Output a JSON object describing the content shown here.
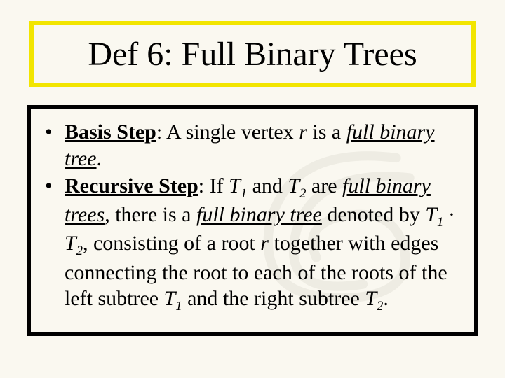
{
  "title": "Def 6: Full Binary Trees",
  "bullets": {
    "basis": {
      "label": "Basis Step",
      "pre": ": A single vertex ",
      "r": "r",
      "mid": " is a ",
      "fbt": "full binary tree",
      "tail": "."
    },
    "recursive": {
      "label": "Recursive Step",
      "p1": ": If ",
      "T1": "T",
      "s1": "1",
      "p2": " and ",
      "T2": "T",
      "s2": "2",
      "p3": " are ",
      "fbt1": "full binary trees",
      "p4": ", there is a ",
      "fbt2": "full binary tree",
      "p5": " denoted by ",
      "notation_T1": "T",
      "notation_s1": "1",
      "notation_dot": " · ",
      "notation_T2": "T",
      "notation_s2": "2",
      "p6": ", consisting of a root ",
      "r": "r",
      "p7": " together with edges connecting the root to each of the roots of the left subtree ",
      "T1b": "T",
      "s1b": "1",
      "p8": " and the right subtree ",
      "T2b": "T",
      "s2b": "2",
      "p9": "."
    }
  }
}
